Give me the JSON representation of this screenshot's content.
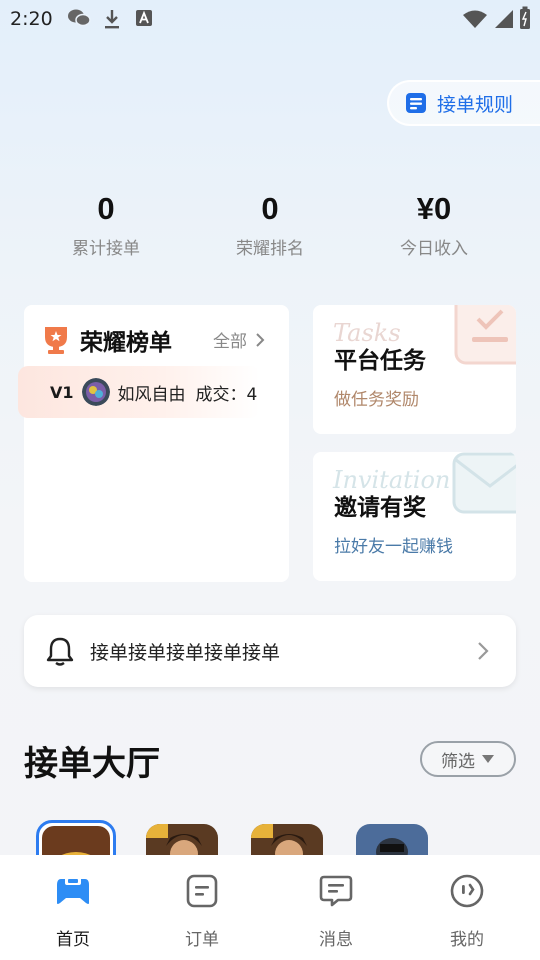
{
  "status_bar": {
    "time": "2:20"
  },
  "header": {
    "rules_label": "接单规则"
  },
  "stats": [
    {
      "value": "0",
      "label": "累计接单"
    },
    {
      "value": "0",
      "label": "荣耀排名"
    },
    {
      "value": "¥0",
      "label": "今日收入"
    }
  ],
  "honor": {
    "title": "荣耀榜单",
    "all_label": "全部",
    "top": {
      "level": "V1",
      "name": "如风自由",
      "deal": "成交：4"
    }
  },
  "task_card": {
    "watermark": "Tasks",
    "title": "平台任务",
    "subtitle": "做任务奖励"
  },
  "invite_card": {
    "watermark": "Invitation",
    "title": "邀请有奖",
    "subtitle": "拉好友一起赚钱"
  },
  "notice": {
    "text": "接单接单接单接单接单"
  },
  "hall": {
    "title": "接单大厅",
    "filter_label": "筛选"
  },
  "colors": {
    "accent": "#1f6ee8",
    "task_sub": "#b0876a",
    "invite_sub": "#4a7aa8"
  },
  "tabbar": [
    {
      "label": "首页",
      "icon": "home-gamepad-icon"
    },
    {
      "label": "订单",
      "icon": "order-icon"
    },
    {
      "label": "消息",
      "icon": "message-icon"
    },
    {
      "label": "我的",
      "icon": "profile-face-icon"
    }
  ]
}
